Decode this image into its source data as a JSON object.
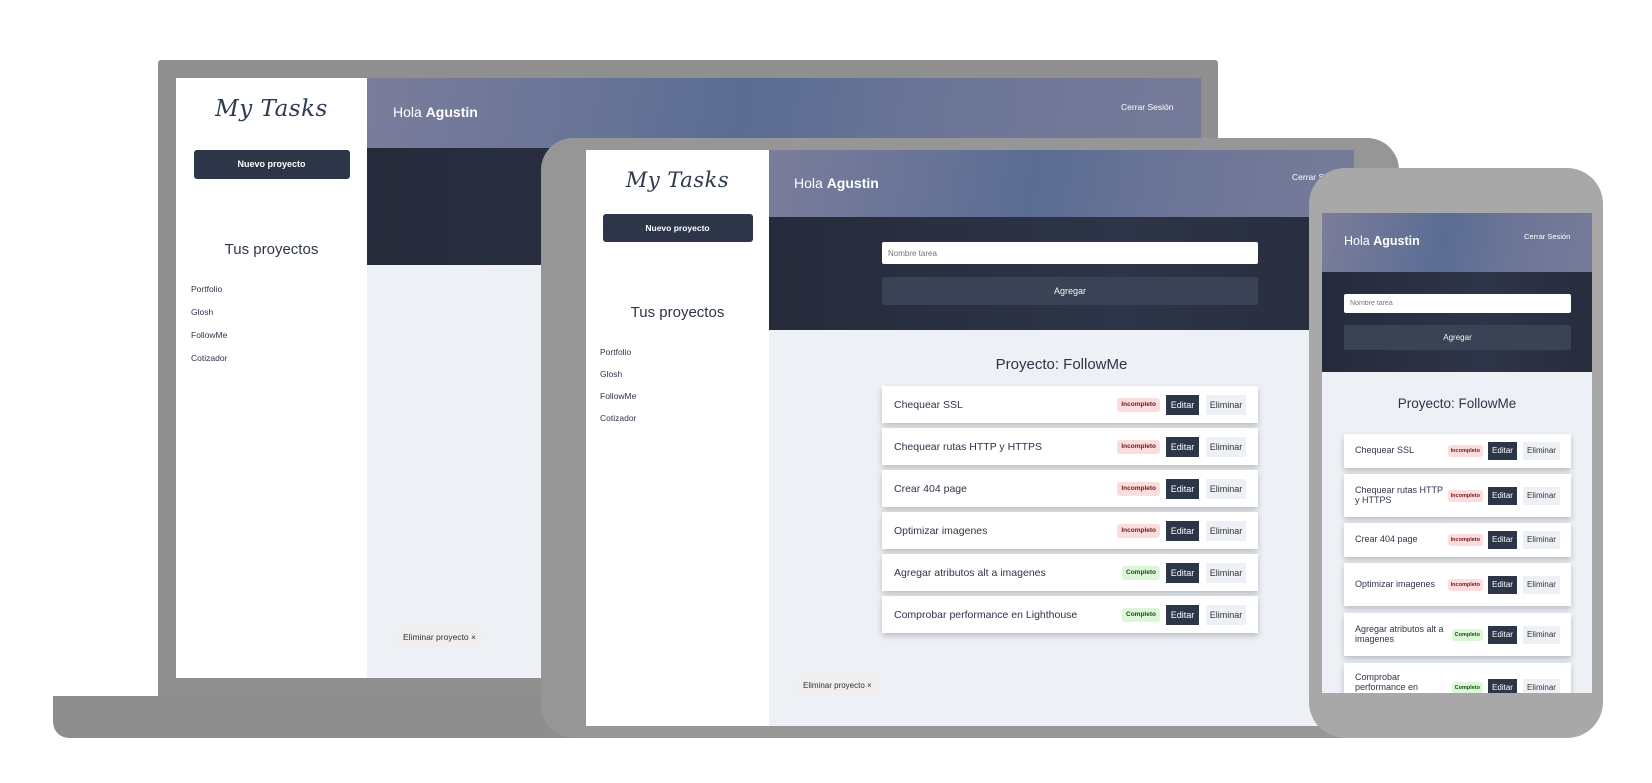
{
  "brand": "My Tasks",
  "new_project_label": "Nuevo proyecto",
  "projects_title": "Tus proyectos",
  "projects": [
    "Portfolio",
    "Glosh",
    "FollowMe",
    "Cotizador"
  ],
  "greeting_prefix": "Hola",
  "user_name": "Agustin",
  "logout_label": "Cerrar Sesión",
  "task_input_placeholder": "Nombre tarea",
  "add_button_label": "Agregar",
  "project_heading": "Proyecto: FollowMe",
  "edit_label": "Editar",
  "delete_label": "Eliminar",
  "delete_project_label": "Eliminar proyecto ×",
  "status_labels": {
    "incomplete": "Incompleto",
    "complete": "Completo"
  },
  "tasks": [
    {
      "name": "Chequear SSL",
      "status": "Incompleto"
    },
    {
      "name": "Chequear rutas HTTP y HTTPS",
      "status": "Incompleto"
    },
    {
      "name": "Crear 404 page",
      "status": "Incompleto"
    },
    {
      "name": "Optimizar imagenes",
      "status": "Incompleto"
    },
    {
      "name": "Agregar atributos alt a imagenes",
      "status": "Completo"
    },
    {
      "name": "Comprobar performance en Lighthouse",
      "status": "Completo"
    }
  ],
  "colors": {
    "primary": "#2d3548",
    "incomplete_bg": "#fcdcdc",
    "complete_bg": "#dcf7d8",
    "canvas": "#edf1f5"
  }
}
